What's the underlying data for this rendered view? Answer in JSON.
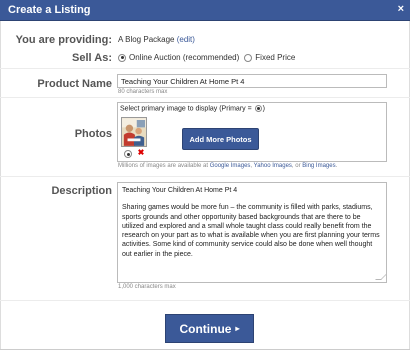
{
  "dialog": {
    "title": "Create a Listing",
    "close_label": "×"
  },
  "providing": {
    "label": "You are providing:",
    "value": "A Blog Package",
    "edit_label": "(edit)"
  },
  "sell_as": {
    "label": "Sell As:",
    "options": [
      {
        "label": "Online Auction (recommended)",
        "selected": true
      },
      {
        "label": "Fixed Price",
        "selected": false
      }
    ]
  },
  "product_name": {
    "label": "Product Name",
    "value": "Teaching Your Children At Home Pt 4",
    "hint": "80 characters max"
  },
  "photos": {
    "label": "Photos",
    "prompt_start": "Select primary image to display (Primary =",
    "prompt_end": ")",
    "add_button": "Add More Photos",
    "delete_icon": "✖",
    "hint_prefix": "Millions of images are available at",
    "links": [
      "Google Images",
      "Yahoo Images",
      "Bing Images"
    ],
    "hint_sep1": ",",
    "hint_sep2": ", or",
    "hint_suffix": "."
  },
  "description": {
    "label": "Description",
    "title_line": "Teaching Your Children At Home Pt 4",
    "body": "Sharing games would be more fun – the community is filled with parks, stadiums, sports grounds and other opportunity based backgrounds that are there to be utilized and explored and a small whole taught class could really benefit from the research on your part as to what is available when you are first planning your terms activities.  Some kind of community service could also be done when well thought out earlier in the piece.",
    "hint": "1,000 characters max"
  },
  "continue_button": {
    "label": "Continue",
    "arrow": "▸"
  },
  "colors": {
    "brand": "#3b5998",
    "brand_dark": "#2d4373",
    "delete": "#dd0000"
  }
}
